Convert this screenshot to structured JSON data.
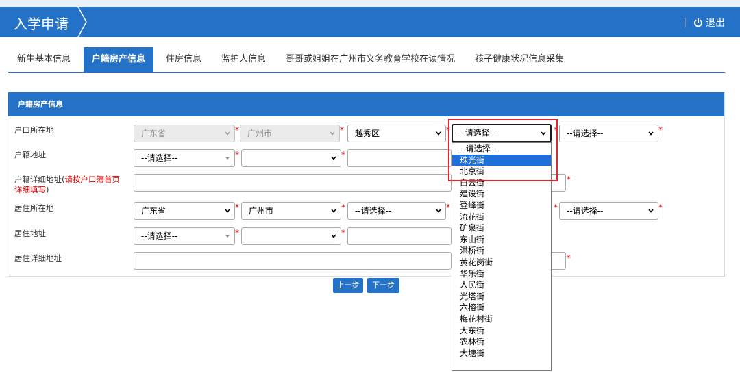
{
  "header": {
    "title": "入学申请",
    "separator": "|",
    "logout_label": "退出"
  },
  "tabs": [
    {
      "label": "新生基本信息",
      "active": false
    },
    {
      "label": "户籍房产信息",
      "active": true
    },
    {
      "label": "住房信息",
      "active": false
    },
    {
      "label": "监护人信息",
      "active": false
    },
    {
      "label": "哥哥或姐姐在广州市义务教育学校在读情况",
      "active": false
    },
    {
      "label": "孩子健康状况信息采集",
      "active": false
    }
  ],
  "panel": {
    "title": "户籍房产信息",
    "fields": {
      "hukou_location_label": "户口所在地",
      "hukou_address_label": "户籍地址",
      "hukou_detail_label_prefix": "户籍详细地址(",
      "hukou_detail_label_red": "请按户口簿首页详细填写",
      "hukou_detail_label_suffix": ")",
      "residence_location_label": "居住所在地",
      "residence_address_label": "居住地址",
      "residence_detail_label": "居住详细地址"
    },
    "selects": {
      "hukou_province": "广东省",
      "hukou_city": "广州市",
      "hukou_district": "越秀区",
      "hukou_street": "--请选择--",
      "hukou_community": "--请选择--",
      "hukou_addr_type": "--请选择--",
      "residence_province": "广东省",
      "residence_city": "广州市",
      "residence_district": "--请选择--",
      "residence_community": "--请选择--",
      "residence_addr_type": "--请选择--"
    },
    "required_mark": "*"
  },
  "buttons": {
    "prev": "上一步",
    "next": "下一步"
  },
  "dropdown": {
    "highlighted_index": 1,
    "options": [
      "--请选择--",
      "珠光街",
      "北京街",
      "白云街",
      "建设街",
      "登峰街",
      "流花街",
      "矿泉街",
      "东山街",
      "洪桥街",
      "黄花岗街",
      "华乐街",
      "人民街",
      "光塔街",
      "六榕街",
      "梅花村街",
      "大东街",
      "农林街",
      "大塘街"
    ]
  },
  "colors": {
    "brand_blue": "#2472c8",
    "required_red": "#e00000",
    "annotation_red": "#e0282e",
    "option_highlight": "#1e6fd9"
  }
}
